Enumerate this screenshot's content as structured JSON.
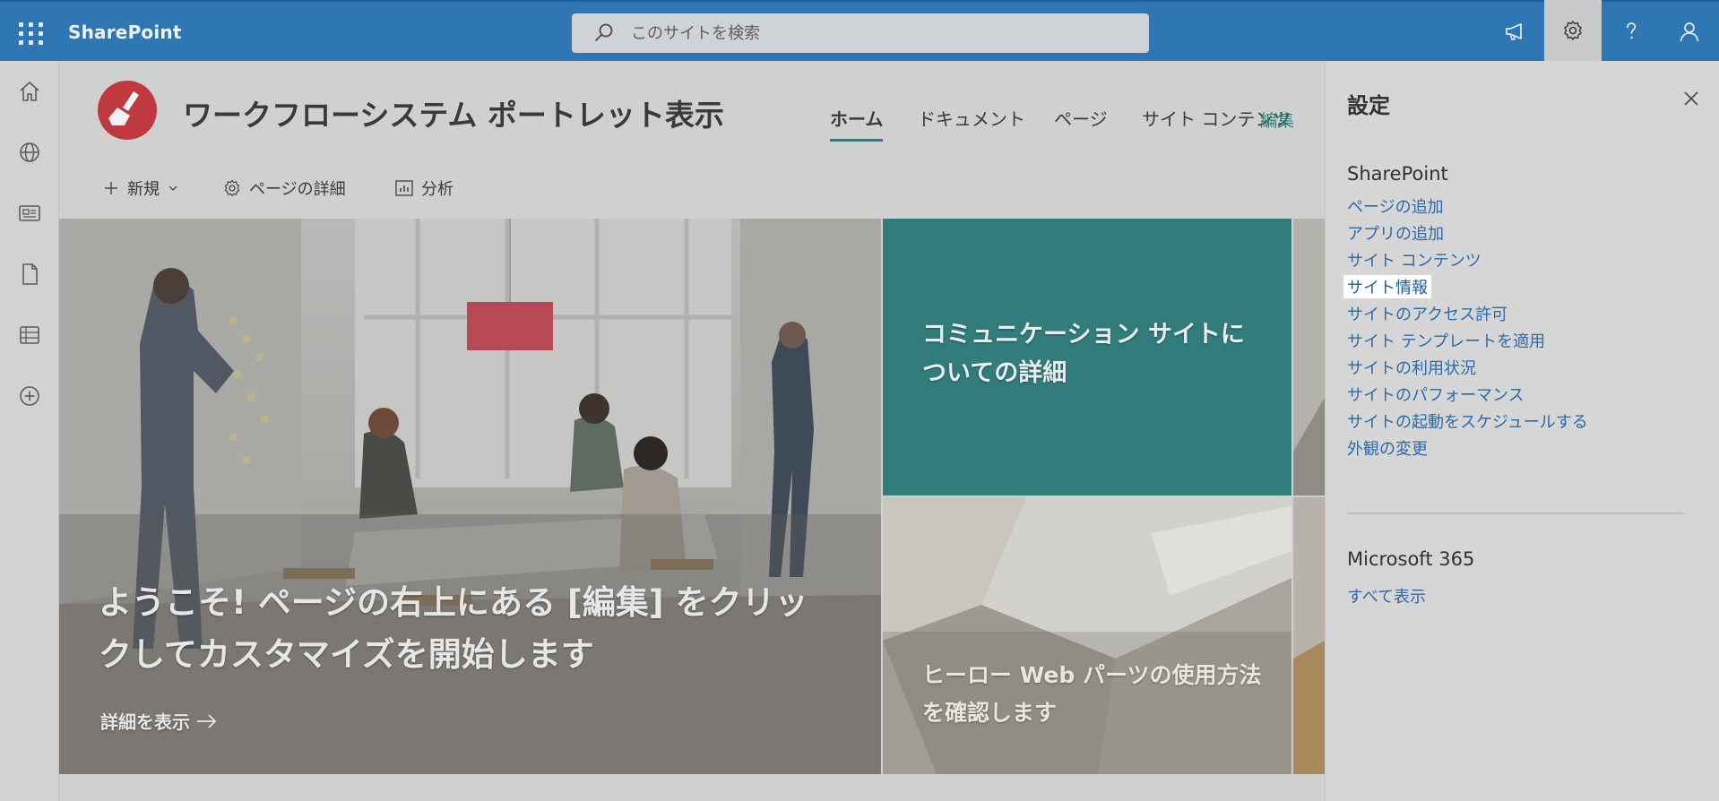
{
  "suite": {
    "brand": "SharePoint",
    "search_placeholder": "このサイトを検索"
  },
  "site": {
    "title": "ワークフローシステム ポートレット表示",
    "nav": [
      {
        "label": "ホーム",
        "active": true
      },
      {
        "label": "ドキュメント",
        "active": false
      },
      {
        "label": "ページ",
        "active": false
      },
      {
        "label": "サイト コンテンツ",
        "active": false
      }
    ],
    "edit_label": "編集"
  },
  "commands": {
    "new_label": "新規",
    "page_details_label": "ページの詳細",
    "analytics_label": "分析"
  },
  "hero": {
    "main_title": "ようこそ! ページの右上にある [編集] をクリックしてカスタマイズを開始します",
    "main_link": "詳細を表示",
    "teal_title": "コミュニケーション サイトについての詳細",
    "arch_title": "ヒーロー Web パーツの使用方法を確認します"
  },
  "settings": {
    "title": "設定",
    "sharepoint_header": "SharePoint",
    "links": [
      "ページの追加",
      "アプリの追加",
      "サイト コンテンツ",
      "サイト情報",
      "サイトのアクセス許可",
      "サイト テンプレートを適用",
      "サイトの利用状況",
      "サイトのパフォーマンス",
      "サイトの起動をスケジュールする",
      "外観の変更"
    ],
    "highlighted_link": "サイト情報",
    "m365_header": "Microsoft 365",
    "m365_link": "すべて表示"
  },
  "colors": {
    "suite_bar": "#2f76b5",
    "accent_teal": "#2a7f7f",
    "link_blue": "#2b6aa8",
    "site_logo": "#c0393f"
  },
  "icons": {
    "topbar": [
      "waffle-icon",
      "megaphone-icon",
      "gear-icon",
      "help-icon",
      "person-icon"
    ],
    "rail": [
      "home-icon",
      "globe-icon",
      "news-icon",
      "file-icon",
      "list-icon",
      "add-circle-icon"
    ]
  }
}
